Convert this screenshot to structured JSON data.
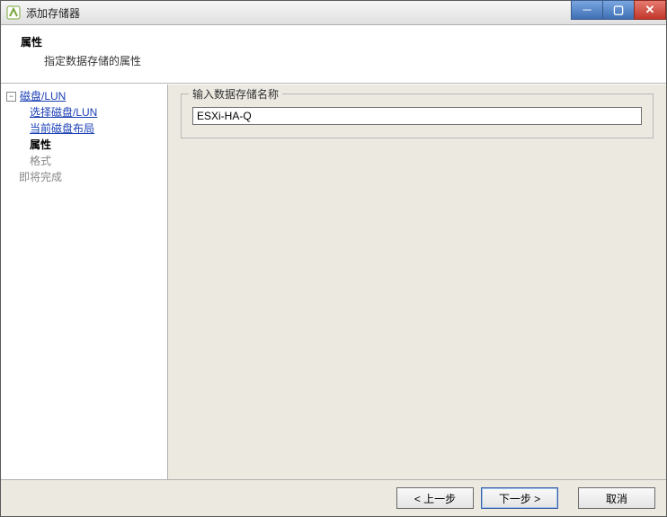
{
  "window": {
    "title": "添加存储器"
  },
  "header": {
    "heading": "属性",
    "subtext": "指定数据存储的属性"
  },
  "nav": {
    "collapse_glyph": "⊟",
    "items": {
      "disk_lun": "磁盘/LUN",
      "select_disk": "选择磁盘/LUN",
      "layout": "当前磁盘布局",
      "properties": "属性",
      "format": "格式",
      "ready": "即将完成"
    }
  },
  "content": {
    "group_label": "输入数据存储名称",
    "input_value": "ESXi-HA-Q"
  },
  "footer": {
    "back": "< 上一步",
    "next": "下一步 >",
    "cancel": "取消"
  },
  "colors": {
    "link": "#1a3fb5",
    "panel": "#ece9e1"
  }
}
